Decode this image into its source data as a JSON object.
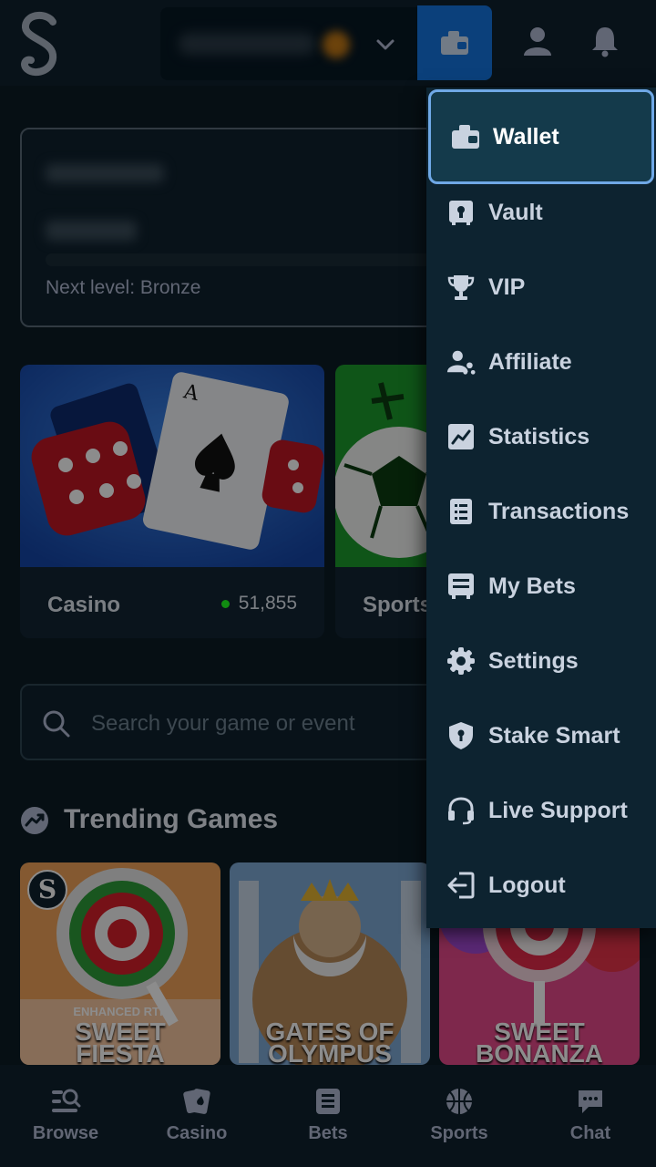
{
  "header": {
    "logo_text": "S",
    "balance_currency_icon": "chevron-down-icon",
    "wallet_icon": "wallet-icon",
    "profile_icon": "user-icon",
    "notifications_icon": "bell-icon"
  },
  "level_card": {
    "next_level_text": "Next level: Bronze"
  },
  "categories": [
    {
      "label": "Casino",
      "count": "51,855"
    },
    {
      "label": "Sports"
    }
  ],
  "search": {
    "placeholder": "Search your game or event"
  },
  "trending": {
    "title": "Trending Games",
    "games": [
      {
        "subtitle": "ENHANCED RTP",
        "title_line1": "SWEET",
        "title_line2": "FIESTA",
        "badge": "S"
      },
      {
        "title_line1": "GATES OF",
        "title_line2": "OLYMPUS"
      },
      {
        "title_line1": "SWEET",
        "title_line2": "BONANZA"
      }
    ]
  },
  "bottom_nav": [
    {
      "label": "Browse",
      "icon": "browse-icon"
    },
    {
      "label": "Casino",
      "icon": "cards-icon"
    },
    {
      "label": "Bets",
      "icon": "bets-list-icon"
    },
    {
      "label": "Sports",
      "icon": "basketball-icon"
    },
    {
      "label": "Chat",
      "icon": "chat-icon"
    }
  ],
  "menu": {
    "items": [
      {
        "label": "Wallet",
        "icon": "wallet-icon",
        "active": true
      },
      {
        "label": "Vault",
        "icon": "vault-icon"
      },
      {
        "label": "VIP",
        "icon": "trophy-icon"
      },
      {
        "label": "Affiliate",
        "icon": "affiliate-icon"
      },
      {
        "label": "Statistics",
        "icon": "chart-icon"
      },
      {
        "label": "Transactions",
        "icon": "list-icon"
      },
      {
        "label": "My Bets",
        "icon": "bets-icon"
      },
      {
        "label": "Settings",
        "icon": "gear-icon"
      },
      {
        "label": "Stake Smart",
        "icon": "shield-icon"
      },
      {
        "label": "Live Support",
        "icon": "headset-icon"
      },
      {
        "label": "Logout",
        "icon": "logout-icon"
      }
    ]
  },
  "colors": {
    "background": "#0f212e",
    "accent_blue": "#1475e1",
    "menu_active": "#143a4b",
    "online_dot": "#1fff20"
  }
}
